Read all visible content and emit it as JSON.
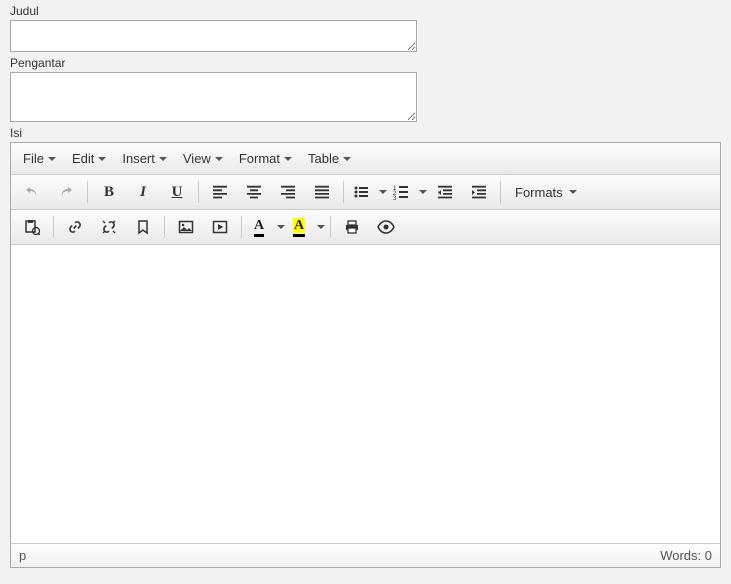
{
  "labels": {
    "judul": "Judul",
    "pengantar": "Pengantar",
    "isi": "Isi"
  },
  "fields": {
    "judul_value": "",
    "pengantar_value": ""
  },
  "editor": {
    "menubar": {
      "file": "File",
      "edit": "Edit",
      "insert": "Insert",
      "view": "View",
      "format": "Format",
      "table": "Table"
    },
    "toolbar": {
      "formats_label": "Formats"
    },
    "icons": {
      "undo": "undo-icon",
      "redo": "redo-icon",
      "bold": "bold-icon",
      "italic": "italic-icon",
      "underline": "underline-icon",
      "align_left": "align-left-icon",
      "align_center": "align-center-icon",
      "align_right": "align-right-icon",
      "align_justify": "align-justify-icon",
      "bullet_list": "bullet-list-icon",
      "number_list": "number-list-icon",
      "outdent": "outdent-icon",
      "indent": "indent-icon",
      "paste_image": "paste-from-clipboard-icon",
      "link": "link-icon",
      "unlink": "unlink-icon",
      "bookmark": "bookmark-icon",
      "image": "image-icon",
      "media": "media-icon",
      "text_color": "text-color-icon",
      "highlight": "highlight-color-icon",
      "print": "print-icon",
      "preview": "preview-icon"
    },
    "status": {
      "path": "p",
      "words_label": "Words:",
      "words_count": 0
    }
  }
}
